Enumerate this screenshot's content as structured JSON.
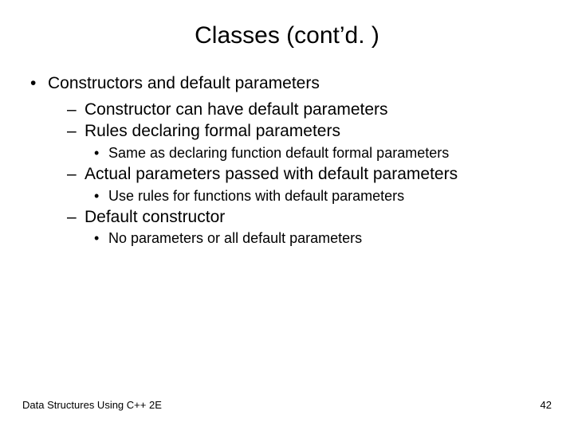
{
  "title": "Classes (cont’d. )",
  "bullets": {
    "b1": "Constructors and default parameters",
    "b1_1": "Constructor can have default parameters",
    "b1_2": "Rules declaring formal parameters",
    "b1_2_1": "Same as declaring function default formal parameters",
    "b1_3": "Actual parameters passed with default parameters",
    "b1_3_1": "Use rules for functions with default parameters",
    "b1_4": "Default constructor",
    "b1_4_1": "No parameters or all default parameters"
  },
  "footer": {
    "source": "Data Structures Using C++ 2E",
    "page": "42"
  }
}
